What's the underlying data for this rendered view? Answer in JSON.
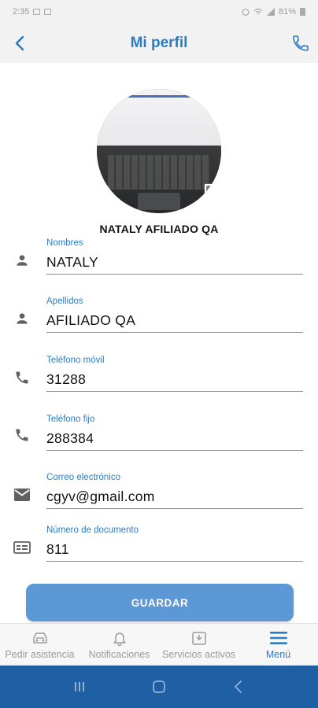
{
  "status_bar": {
    "time": "2:35",
    "battery": "81%"
  },
  "header": {
    "title": "Mi perfil"
  },
  "profile": {
    "name": "NATALY AFILIADO QA"
  },
  "fields": [
    {
      "label": "Nombres",
      "value": "NATALY",
      "icon": "person-icon"
    },
    {
      "label": "Apellidos",
      "value": "AFILIADO QA",
      "icon": "person-icon"
    },
    {
      "label": "Teléfono móvil",
      "value": "31288",
      "icon": "phone-icon"
    },
    {
      "label": "Teléfono fijo",
      "value": "288384",
      "icon": "phone-icon"
    },
    {
      "label": "Correo electrónico",
      "value": "cgyv@gmail.com",
      "icon": "email-icon"
    },
    {
      "label": "Número de documento",
      "value": "811",
      "icon": "id-card-icon"
    }
  ],
  "save_button": {
    "label": "GUARDAR"
  },
  "bottom_nav": [
    {
      "label": "Pedir asistencia",
      "icon": "car-icon",
      "active": false
    },
    {
      "label": "Notificaciones",
      "icon": "bell-icon",
      "active": false
    },
    {
      "label": "Servicios activos",
      "icon": "services-icon",
      "active": false
    },
    {
      "label": "Menú",
      "icon": "hamburger-menu-icon",
      "active": true
    }
  ],
  "colors": {
    "accent": "#2d7cc3",
    "button": "#5d98d6",
    "header_bg": "#f2f2f2",
    "system_nav": "#1f5fa4",
    "inactive": "#9a9a9a"
  }
}
